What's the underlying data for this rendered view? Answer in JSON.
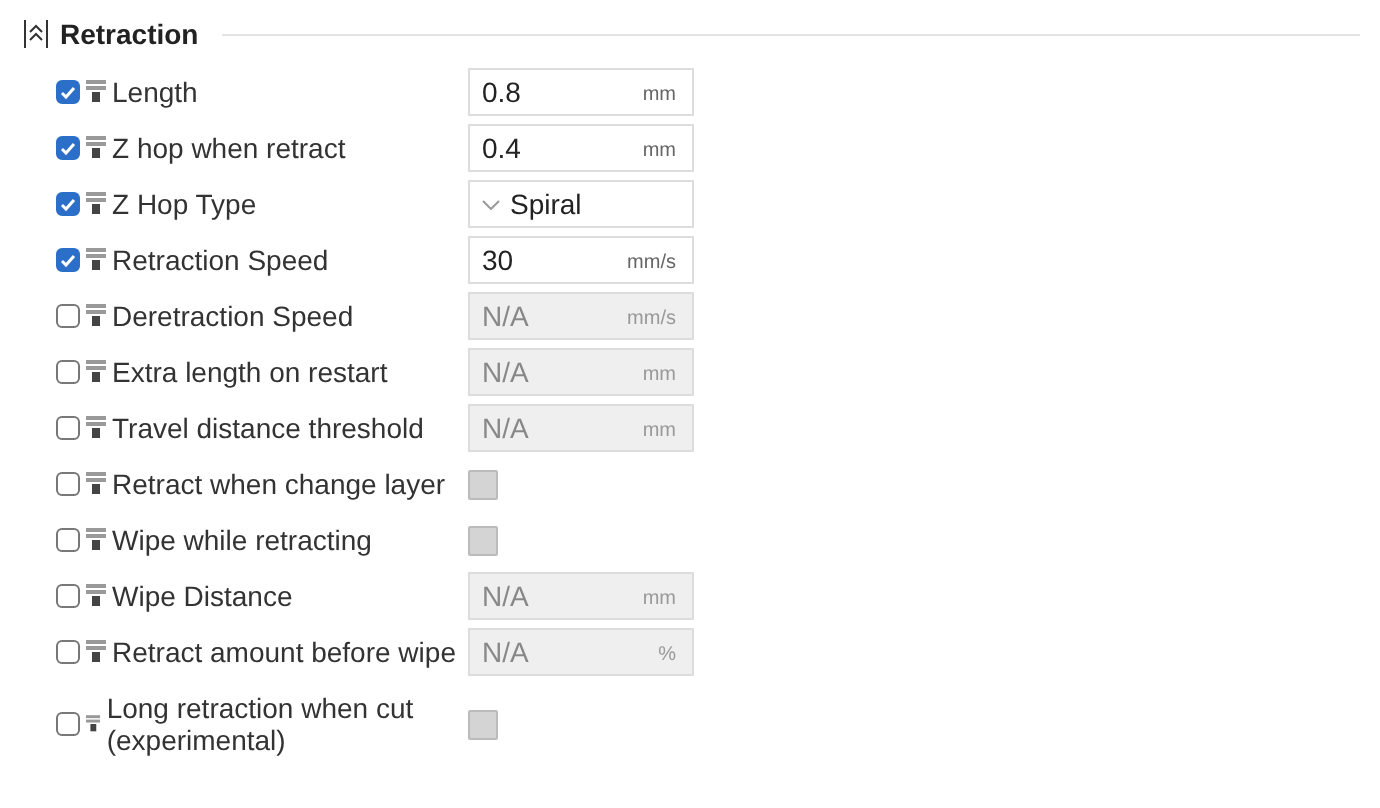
{
  "section": {
    "title": "Retraction",
    "expanded": true
  },
  "rows": [
    {
      "label": "Length",
      "checked": true,
      "kind": "number",
      "value": "0.8",
      "unit": "mm"
    },
    {
      "label": "Z hop when retract",
      "checked": true,
      "kind": "number",
      "value": "0.4",
      "unit": "mm"
    },
    {
      "label": "Z Hop Type",
      "checked": true,
      "kind": "dropdown",
      "value": "Spiral"
    },
    {
      "label": "Retraction Speed",
      "checked": true,
      "kind": "number",
      "value": "30",
      "unit": "mm/s"
    },
    {
      "label": "Deretraction Speed",
      "checked": false,
      "kind": "number",
      "value": "N/A",
      "unit": "mm/s"
    },
    {
      "label": "Extra length on restart",
      "checked": false,
      "kind": "number",
      "value": "N/A",
      "unit": "mm"
    },
    {
      "label": "Travel distance threshold",
      "checked": false,
      "kind": "number",
      "value": "N/A",
      "unit": "mm"
    },
    {
      "label": "Retract when change layer",
      "checked": false,
      "kind": "toggle"
    },
    {
      "label": "Wipe while retracting",
      "checked": false,
      "kind": "toggle"
    },
    {
      "label": "Wipe Distance",
      "checked": false,
      "kind": "number",
      "value": "N/A",
      "unit": "mm"
    },
    {
      "label": "Retract amount before wipe",
      "checked": false,
      "kind": "number",
      "value": "N/A",
      "unit": "%"
    },
    {
      "label": "Long retraction when cut (experimental)",
      "checked": false,
      "kind": "toggle"
    }
  ]
}
